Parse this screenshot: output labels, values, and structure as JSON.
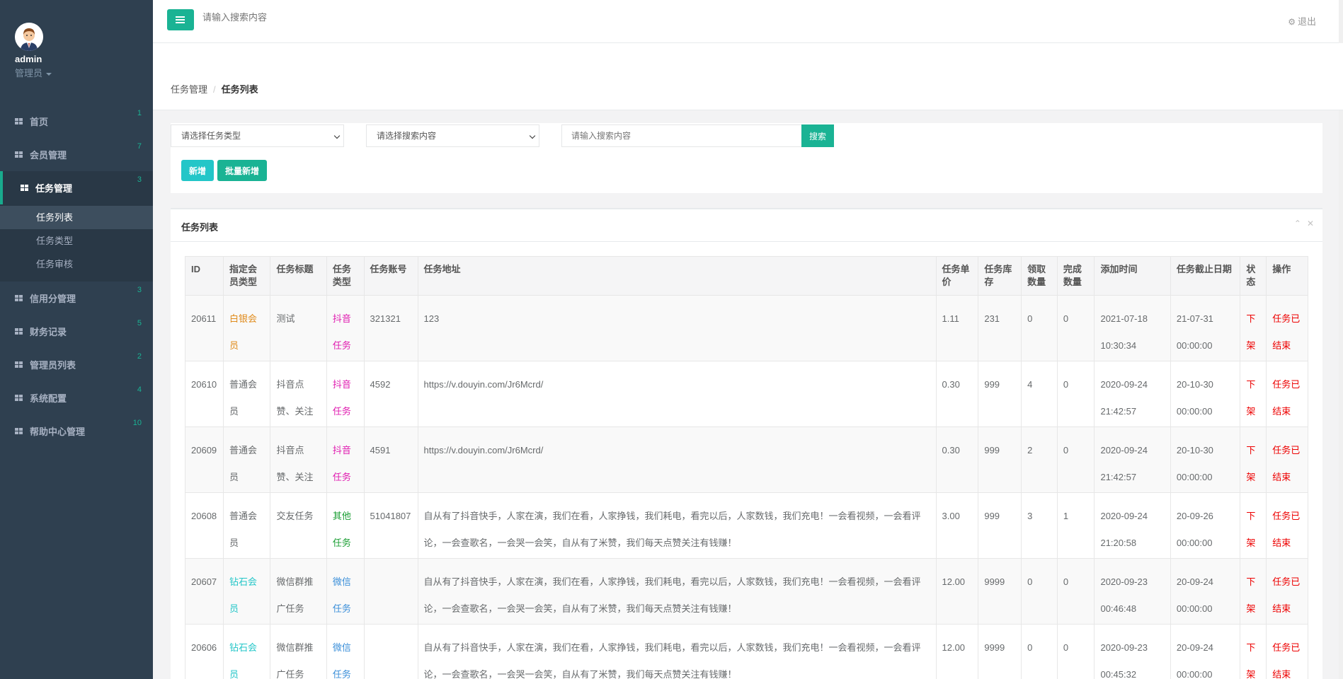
{
  "user": {
    "name": "admin",
    "role": "管理员"
  },
  "nav": {
    "items": [
      {
        "label": "首页",
        "badge": "1"
      },
      {
        "label": "会员管理",
        "badge": "7"
      },
      {
        "label": "任务管理",
        "badge": "3"
      },
      {
        "label": "信用分管理",
        "badge": "3"
      },
      {
        "label": "财务记录",
        "badge": "5"
      },
      {
        "label": "管理员列表",
        "badge": "2"
      },
      {
        "label": "系统配置",
        "badge": "4"
      },
      {
        "label": "帮助中心管理",
        "badge": "10"
      }
    ],
    "sub_items": [
      "任务列表",
      "任务类型",
      "任务审核"
    ]
  },
  "topbar": {
    "search_placeholder": "请输入搜索内容",
    "logout_label": "退出"
  },
  "breadcrumb": {
    "parent": "任务管理",
    "current": "任务列表",
    "separator": "/"
  },
  "filter": {
    "task_type_placeholder": "请选择任务类型",
    "search_field_placeholder": "请选择搜索内容",
    "search_input_placeholder": "请输入搜索内容",
    "search_button": "搜索",
    "add_button": "新增",
    "batch_add_button": "批量新增"
  },
  "panel": {
    "title": "任务列表"
  },
  "table": {
    "headers": {
      "id": "ID",
      "member_type_1": "指定会",
      "member_type_2": "员类型",
      "title": "任务标题",
      "type_1": "任务",
      "type_2": "类型",
      "account": "任务账号",
      "url": "任务地址",
      "price_1": "任务单",
      "price_2": "价",
      "stock_1": "任务库",
      "stock_2": "存",
      "claimed_1": "领取",
      "claimed_2": "数量",
      "done_1": "完成",
      "done_2": "数量",
      "added": "添加时间",
      "deadline": "任务截止日期",
      "status_1": "状",
      "status_2": "态",
      "action": "操作"
    },
    "rows": [
      {
        "id": "20611",
        "member_1": "白银会",
        "member_2": "员",
        "title_1": "测试",
        "title_2": "",
        "type_1": "抖音",
        "type_2": "任务",
        "account": "321321",
        "url_1": "123",
        "url_2": "",
        "price": "1.11",
        "stock": "231",
        "claimed": "0",
        "done": "0",
        "added_1": "2021-07-18",
        "added_2": "10:30:34",
        "deadline_1": "21-07-31",
        "deadline_2": "00:00:00",
        "status_1": "下",
        "status_2": "架",
        "action_1": "任务已",
        "action_2": "结束"
      },
      {
        "id": "20610",
        "member_1": "普通会",
        "member_2": "员",
        "title_1": "抖音点",
        "title_2": "赞、关注",
        "type_1": "抖音",
        "type_2": "任务",
        "account": "4592",
        "url_1": "https://v.douyin.com/Jr6Mcrd/",
        "url_2": "",
        "price": "0.30",
        "stock": "999",
        "claimed": "4",
        "done": "0",
        "added_1": "2020-09-24",
        "added_2": "21:42:57",
        "deadline_1": "20-10-30",
        "deadline_2": "00:00:00",
        "status_1": "下",
        "status_2": "架",
        "action_1": "任务已",
        "action_2": "结束"
      },
      {
        "id": "20609",
        "member_1": "普通会",
        "member_2": "员",
        "title_1": "抖音点",
        "title_2": "赞、关注",
        "type_1": "抖音",
        "type_2": "任务",
        "account": "4591",
        "url_1": "https://v.douyin.com/Jr6Mcrd/",
        "url_2": "",
        "price": "0.30",
        "stock": "999",
        "claimed": "2",
        "done": "0",
        "added_1": "2020-09-24",
        "added_2": "21:42:57",
        "deadline_1": "20-10-30",
        "deadline_2": "00:00:00",
        "status_1": "下",
        "status_2": "架",
        "action_1": "任务已",
        "action_2": "结束"
      },
      {
        "id": "20608",
        "member_1": "普通会",
        "member_2": "员",
        "title_1": "交友任务",
        "title_2": "",
        "type_1": "其他",
        "type_2": "任务",
        "account": "51041807",
        "url_1": "自从有了抖音快手，人家在演，我们在看，人家挣钱，我们耗电，看完以后，人家数钱，我们充电！一会看视频，一会看评",
        "url_2": "论，一会查歌名，一会哭一会笑，自从有了米赞，我们每天点赞关注有钱赚！",
        "price": "3.00",
        "stock": "999",
        "claimed": "3",
        "done": "1",
        "added_1": "2020-09-24",
        "added_2": "21:20:58",
        "deadline_1": "20-09-26",
        "deadline_2": "00:00:00",
        "status_1": "下",
        "status_2": "架",
        "action_1": "任务已",
        "action_2": "结束"
      },
      {
        "id": "20607",
        "member_1": "钻石会",
        "member_2": "员",
        "title_1": "微信群推",
        "title_2": "广任务",
        "type_1": "微信",
        "type_2": "任务",
        "account": "",
        "url_1": "自从有了抖音快手，人家在演，我们在看，人家挣钱，我们耗电，看完以后，人家数钱，我们充电！一会看视频，一会看评",
        "url_2": "论，一会查歌名，一会哭一会笑，自从有了米赞，我们每天点赞关注有钱赚！",
        "price": "12.00",
        "stock": "9999",
        "claimed": "0",
        "done": "0",
        "added_1": "2020-09-23",
        "added_2": "00:46:48",
        "deadline_1": "20-09-24",
        "deadline_2": "00:00:00",
        "status_1": "下",
        "status_2": "架",
        "action_1": "任务已",
        "action_2": "结束"
      },
      {
        "id": "20606",
        "member_1": "钻石会",
        "member_2": "员",
        "title_1": "微信群推",
        "title_2": "广任务",
        "type_1": "微信",
        "type_2": "任务",
        "account": "",
        "url_1": "自从有了抖音快手，人家在演，我们在看，人家挣钱，我们耗电，看完以后，人家数钱，我们充电！一会看视频，一会看评",
        "url_2": "论，一会查歌名，一会哭一会笑，自从有了米赞，我们每天点赞关注有钱赚！",
        "price": "12.00",
        "stock": "9999",
        "claimed": "0",
        "done": "0",
        "added_1": "2020-09-23",
        "added_2": "00:45:32",
        "deadline_1": "20-09-24",
        "deadline_2": "00:00:00",
        "status_1": "下",
        "status_2": "架",
        "action_1": "任务已",
        "action_2": "结束"
      }
    ]
  }
}
